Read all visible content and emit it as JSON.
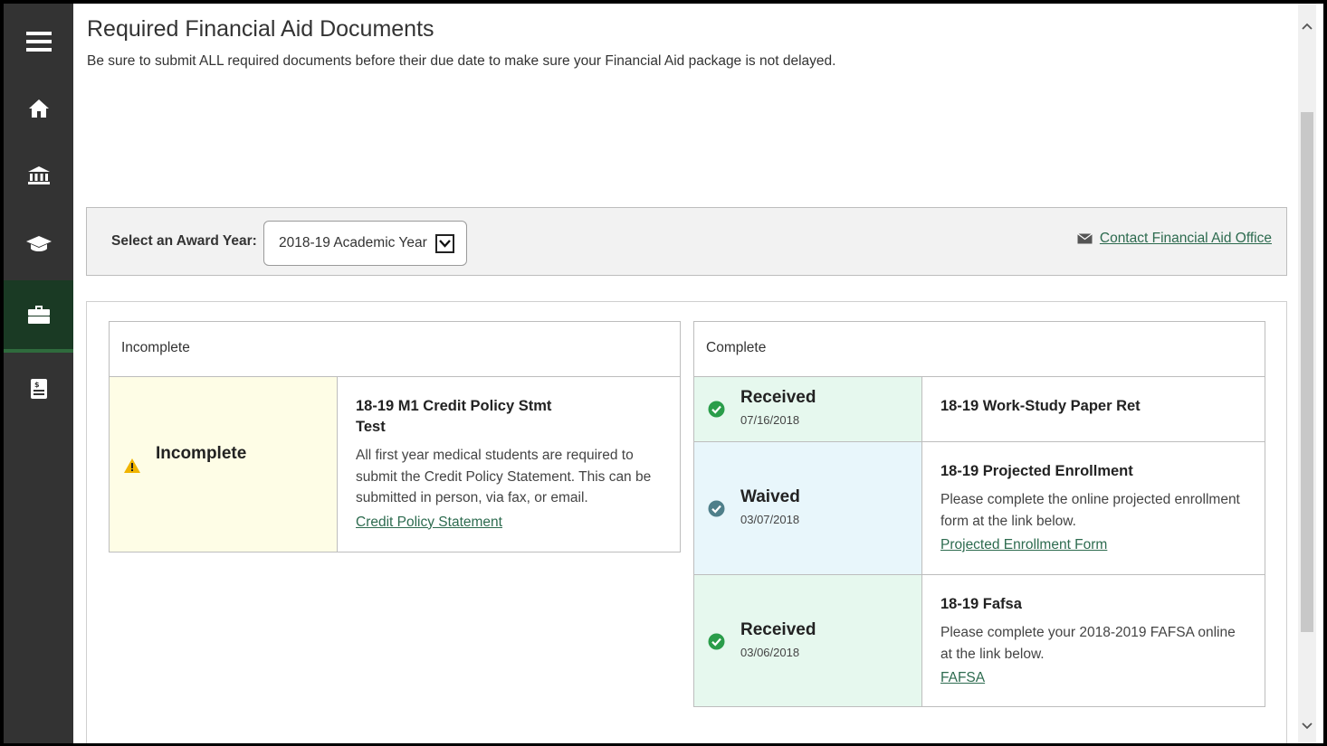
{
  "page": {
    "title": "Required Financial Aid Documents",
    "description": "Be sure to submit ALL required documents before their due date to make sure your Financial Aid package is not delayed."
  },
  "sidebar": {
    "items": [
      {
        "name": "menu-icon"
      },
      {
        "name": "home-icon"
      },
      {
        "name": "bank-icon"
      },
      {
        "name": "graduation-cap-icon"
      },
      {
        "name": "briefcase-icon"
      },
      {
        "name": "bill-icon"
      }
    ]
  },
  "filter": {
    "label": "Select an Award Year:",
    "selected_year": "2018-19 Academic Year",
    "contact_link": "Contact Financial Aid Office"
  },
  "incomplete": {
    "header": "Incomplete",
    "items": [
      {
        "status": "Incomplete",
        "title_line1": "18-19 M1 Credit Policy Stmt",
        "title_line2": "Test",
        "description": "All first year medical students are required to submit the Credit Policy Statement. This can be submitted in person, via fax, or email.",
        "link": "Credit Policy Statement"
      }
    ]
  },
  "complete": {
    "header": "Complete",
    "items": [
      {
        "status": "Received",
        "date": "07/16/2018",
        "title": "18-19 Work-Study Paper Ret"
      },
      {
        "status": "Waived",
        "date": "03/07/2018",
        "title": "18-19 Projected Enrollment",
        "description": "Please complete the online projected enrollment form at the link below.",
        "link": "Projected Enrollment Form"
      },
      {
        "status": "Received",
        "date": "03/06/2018",
        "title": "18-19 Fafsa",
        "description": "Please complete your 2018-2019 FAFSA online at the link below.",
        "link": "FAFSA"
      }
    ]
  },
  "colors": {
    "sidebar": "#333333",
    "active_nav": "#1a3a24",
    "link": "#2d6b4f",
    "warning": "#f0b400",
    "success": "#2a9d4a",
    "waived": "#4f7f8a"
  }
}
